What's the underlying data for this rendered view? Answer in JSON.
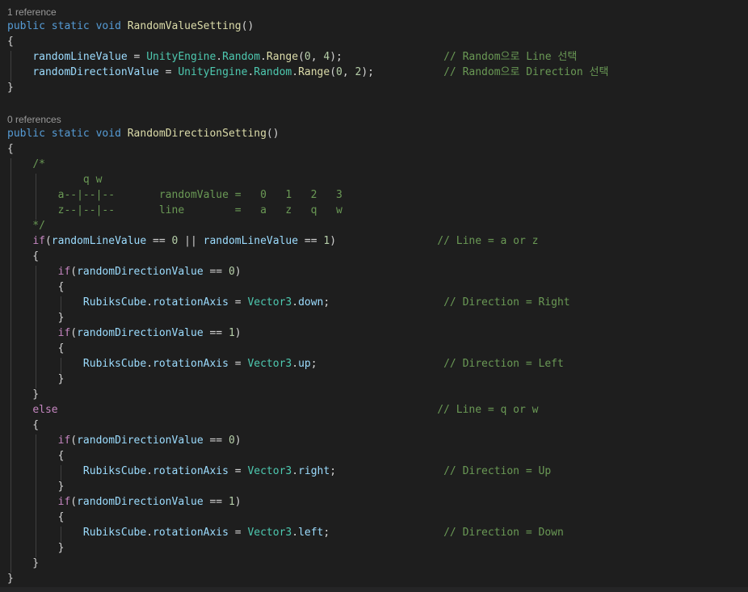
{
  "editor": {
    "lines": [
      {
        "type": "lens",
        "text": "1 reference"
      },
      {
        "type": "code",
        "tokens": [
          {
            "c": "kw",
            "t": "public"
          },
          {
            "c": "pun",
            "t": " "
          },
          {
            "c": "kw",
            "t": "static"
          },
          {
            "c": "pun",
            "t": " "
          },
          {
            "c": "kw",
            "t": "void"
          },
          {
            "c": "pun",
            "t": " "
          },
          {
            "c": "fn",
            "t": "RandomValueSetting"
          },
          {
            "c": "pun",
            "t": "()"
          }
        ]
      },
      {
        "type": "code",
        "tokens": [
          {
            "c": "pun",
            "t": "{"
          }
        ]
      },
      {
        "type": "code",
        "tokens": [
          {
            "c": "pun",
            "t": "    "
          },
          {
            "c": "var",
            "t": "randomLineValue"
          },
          {
            "c": "pun",
            "t": " = "
          },
          {
            "c": "typ",
            "t": "UnityEngine"
          },
          {
            "c": "pun",
            "t": "."
          },
          {
            "c": "typ",
            "t": "Random"
          },
          {
            "c": "pun",
            "t": "."
          },
          {
            "c": "fn",
            "t": "Range"
          },
          {
            "c": "pun",
            "t": "("
          },
          {
            "c": "num",
            "t": "0"
          },
          {
            "c": "pun",
            "t": ", "
          },
          {
            "c": "num",
            "t": "4"
          },
          {
            "c": "pun",
            "t": ");"
          },
          {
            "c": "pun",
            "t": "                "
          },
          {
            "c": "cmt",
            "t": "// Random으로 Line 선택"
          }
        ]
      },
      {
        "type": "code",
        "tokens": [
          {
            "c": "pun",
            "t": "    "
          },
          {
            "c": "var",
            "t": "randomDirectionValue"
          },
          {
            "c": "pun",
            "t": " = "
          },
          {
            "c": "typ",
            "t": "UnityEngine"
          },
          {
            "c": "pun",
            "t": "."
          },
          {
            "c": "typ",
            "t": "Random"
          },
          {
            "c": "pun",
            "t": "."
          },
          {
            "c": "fn",
            "t": "Range"
          },
          {
            "c": "pun",
            "t": "("
          },
          {
            "c": "num",
            "t": "0"
          },
          {
            "c": "pun",
            "t": ", "
          },
          {
            "c": "num",
            "t": "2"
          },
          {
            "c": "pun",
            "t": ");"
          },
          {
            "c": "pun",
            "t": "           "
          },
          {
            "c": "cmt",
            "t": "// Random으로 Direction 선택"
          }
        ]
      },
      {
        "type": "code",
        "tokens": [
          {
            "c": "pun",
            "t": "}"
          }
        ]
      },
      {
        "type": "code",
        "tokens": []
      },
      {
        "type": "lens",
        "text": "0 references"
      },
      {
        "type": "code",
        "tokens": [
          {
            "c": "kw",
            "t": "public"
          },
          {
            "c": "pun",
            "t": " "
          },
          {
            "c": "kw",
            "t": "static"
          },
          {
            "c": "pun",
            "t": " "
          },
          {
            "c": "kw",
            "t": "void"
          },
          {
            "c": "pun",
            "t": " "
          },
          {
            "c": "fn",
            "t": "RandomDirectionSetting"
          },
          {
            "c": "pun",
            "t": "()"
          }
        ]
      },
      {
        "type": "code",
        "tokens": [
          {
            "c": "pun",
            "t": "{"
          }
        ]
      },
      {
        "type": "code",
        "tokens": [
          {
            "c": "pun",
            "t": "    "
          },
          {
            "c": "cmt",
            "t": "/*"
          }
        ]
      },
      {
        "type": "code",
        "tokens": [
          {
            "c": "cmt",
            "t": "            q w"
          }
        ]
      },
      {
        "type": "code",
        "tokens": [
          {
            "c": "cmt",
            "t": "        a--|--|--       randomValue =   0   1   2   3"
          }
        ]
      },
      {
        "type": "code",
        "tokens": [
          {
            "c": "cmt",
            "t": "        z--|--|--       line        =   a   z   q   w"
          }
        ]
      },
      {
        "type": "code",
        "tokens": [
          {
            "c": "cmt",
            "t": "    */"
          }
        ]
      },
      {
        "type": "code",
        "tokens": [
          {
            "c": "pun",
            "t": "    "
          },
          {
            "c": "ctl",
            "t": "if"
          },
          {
            "c": "pun",
            "t": "("
          },
          {
            "c": "var",
            "t": "randomLineValue"
          },
          {
            "c": "pun",
            "t": " == "
          },
          {
            "c": "num",
            "t": "0"
          },
          {
            "c": "pun",
            "t": " || "
          },
          {
            "c": "var",
            "t": "randomLineValue"
          },
          {
            "c": "pun",
            "t": " == "
          },
          {
            "c": "num",
            "t": "1"
          },
          {
            "c": "pun",
            "t": ")"
          },
          {
            "c": "pun",
            "t": "                "
          },
          {
            "c": "cmt",
            "t": "// Line = a or z"
          }
        ]
      },
      {
        "type": "code",
        "tokens": [
          {
            "c": "pun",
            "t": "    {"
          }
        ]
      },
      {
        "type": "code",
        "tokens": [
          {
            "c": "pun",
            "t": "        "
          },
          {
            "c": "ctl",
            "t": "if"
          },
          {
            "c": "pun",
            "t": "("
          },
          {
            "c": "var",
            "t": "randomDirectionValue"
          },
          {
            "c": "pun",
            "t": " == "
          },
          {
            "c": "num",
            "t": "0"
          },
          {
            "c": "pun",
            "t": ")"
          }
        ]
      },
      {
        "type": "code",
        "tokens": [
          {
            "c": "pun",
            "t": "        {"
          }
        ]
      },
      {
        "type": "code",
        "tokens": [
          {
            "c": "pun",
            "t": "            "
          },
          {
            "c": "var",
            "t": "RubiksCube"
          },
          {
            "c": "pun",
            "t": "."
          },
          {
            "c": "var",
            "t": "rotationAxis"
          },
          {
            "c": "pun",
            "t": " = "
          },
          {
            "c": "typ",
            "t": "Vector3"
          },
          {
            "c": "pun",
            "t": "."
          },
          {
            "c": "var",
            "t": "down"
          },
          {
            "c": "pun",
            "t": ";"
          },
          {
            "c": "pun",
            "t": "                  "
          },
          {
            "c": "cmt",
            "t": "// Direction = Right"
          }
        ]
      },
      {
        "type": "code",
        "tokens": [
          {
            "c": "pun",
            "t": "        }"
          }
        ]
      },
      {
        "type": "code",
        "tokens": [
          {
            "c": "pun",
            "t": "        "
          },
          {
            "c": "ctl",
            "t": "if"
          },
          {
            "c": "pun",
            "t": "("
          },
          {
            "c": "var",
            "t": "randomDirectionValue"
          },
          {
            "c": "pun",
            "t": " == "
          },
          {
            "c": "num",
            "t": "1"
          },
          {
            "c": "pun",
            "t": ")"
          }
        ]
      },
      {
        "type": "code",
        "tokens": [
          {
            "c": "pun",
            "t": "        {"
          }
        ]
      },
      {
        "type": "code",
        "tokens": [
          {
            "c": "pun",
            "t": "            "
          },
          {
            "c": "var",
            "t": "RubiksCube"
          },
          {
            "c": "pun",
            "t": "."
          },
          {
            "c": "var",
            "t": "rotationAxis"
          },
          {
            "c": "pun",
            "t": " = "
          },
          {
            "c": "typ",
            "t": "Vector3"
          },
          {
            "c": "pun",
            "t": "."
          },
          {
            "c": "var",
            "t": "up"
          },
          {
            "c": "pun",
            "t": ";"
          },
          {
            "c": "pun",
            "t": "                    "
          },
          {
            "c": "cmt",
            "t": "// Direction = Left"
          }
        ]
      },
      {
        "type": "code",
        "tokens": [
          {
            "c": "pun",
            "t": "        }"
          }
        ]
      },
      {
        "type": "code",
        "tokens": [
          {
            "c": "pun",
            "t": "    }"
          }
        ]
      },
      {
        "type": "code",
        "tokens": [
          {
            "c": "pun",
            "t": "    "
          },
          {
            "c": "ctl",
            "t": "else"
          },
          {
            "c": "pun",
            "t": "                                                            "
          },
          {
            "c": "cmt",
            "t": "// Line = q or w"
          }
        ]
      },
      {
        "type": "code",
        "tokens": [
          {
            "c": "pun",
            "t": "    {"
          }
        ]
      },
      {
        "type": "code",
        "tokens": [
          {
            "c": "pun",
            "t": "        "
          },
          {
            "c": "ctl",
            "t": "if"
          },
          {
            "c": "pun",
            "t": "("
          },
          {
            "c": "var",
            "t": "randomDirectionValue"
          },
          {
            "c": "pun",
            "t": " == "
          },
          {
            "c": "num",
            "t": "0"
          },
          {
            "c": "pun",
            "t": ")"
          }
        ]
      },
      {
        "type": "code",
        "tokens": [
          {
            "c": "pun",
            "t": "        {"
          }
        ]
      },
      {
        "type": "code",
        "tokens": [
          {
            "c": "pun",
            "t": "            "
          },
          {
            "c": "var",
            "t": "RubiksCube"
          },
          {
            "c": "pun",
            "t": "."
          },
          {
            "c": "var",
            "t": "rotationAxis"
          },
          {
            "c": "pun",
            "t": " = "
          },
          {
            "c": "typ",
            "t": "Vector3"
          },
          {
            "c": "pun",
            "t": "."
          },
          {
            "c": "var",
            "t": "right"
          },
          {
            "c": "pun",
            "t": ";"
          },
          {
            "c": "pun",
            "t": "                 "
          },
          {
            "c": "cmt",
            "t": "// Direction = Up"
          }
        ]
      },
      {
        "type": "code",
        "tokens": [
          {
            "c": "pun",
            "t": "        }"
          }
        ]
      },
      {
        "type": "code",
        "tokens": [
          {
            "c": "pun",
            "t": "        "
          },
          {
            "c": "ctl",
            "t": "if"
          },
          {
            "c": "pun",
            "t": "("
          },
          {
            "c": "var",
            "t": "randomDirectionValue"
          },
          {
            "c": "pun",
            "t": " == "
          },
          {
            "c": "num",
            "t": "1"
          },
          {
            "c": "pun",
            "t": ")"
          }
        ]
      },
      {
        "type": "code",
        "tokens": [
          {
            "c": "pun",
            "t": "        {"
          }
        ]
      },
      {
        "type": "code",
        "tokens": [
          {
            "c": "pun",
            "t": "            "
          },
          {
            "c": "var",
            "t": "RubiksCube"
          },
          {
            "c": "pun",
            "t": "."
          },
          {
            "c": "var",
            "t": "rotationAxis"
          },
          {
            "c": "pun",
            "t": " = "
          },
          {
            "c": "typ",
            "t": "Vector3"
          },
          {
            "c": "pun",
            "t": "."
          },
          {
            "c": "var",
            "t": "left"
          },
          {
            "c": "pun",
            "t": ";"
          },
          {
            "c": "pun",
            "t": "                  "
          },
          {
            "c": "cmt",
            "t": "// Direction = Down"
          }
        ]
      },
      {
        "type": "code",
        "tokens": [
          {
            "c": "pun",
            "t": "        }"
          }
        ]
      },
      {
        "type": "code",
        "tokens": [
          {
            "c": "pun",
            "t": "    }"
          }
        ]
      },
      {
        "type": "code",
        "tokens": [
          {
            "c": "pun",
            "t": "}"
          }
        ]
      }
    ]
  }
}
